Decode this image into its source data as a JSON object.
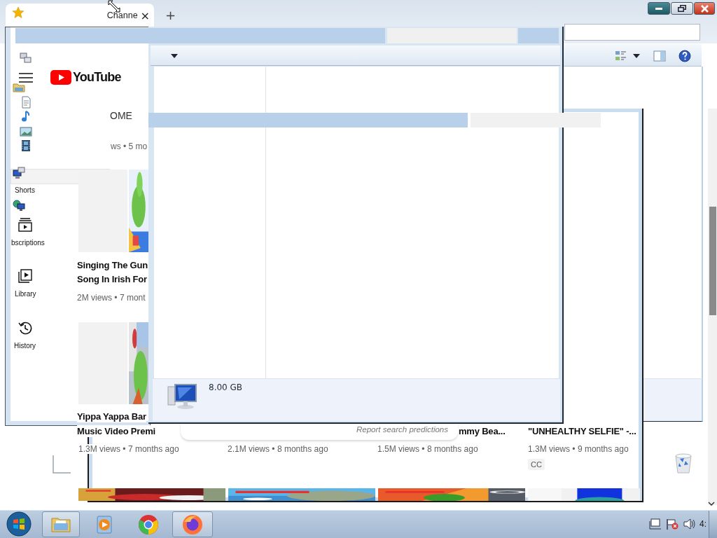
{
  "browser": {
    "tabs": [
      {
        "label": "Channe",
        "close": "×",
        "selected": true
      }
    ],
    "new_tab": "+"
  },
  "youtube": {
    "logo_text": "YouTube",
    "top_chip": "OME",
    "top_meta": "ws • 5 mo",
    "nav_items": [
      {
        "label": "Shorts",
        "kind": "plain"
      },
      {
        "label": "bscriptions",
        "kind": "subscriptions"
      },
      {
        "label": "Library",
        "kind": "library"
      },
      {
        "label": "History",
        "kind": "history"
      }
    ],
    "videos": [
      {
        "title_lines": [
          "Singing The Gun",
          "Song In Irish For"
        ],
        "meta": "2M views • 7 mont"
      },
      {
        "title_lines": [
          "Yippa Yappa Bar",
          "Music Video Premi"
        ],
        "meta": "1.3M views • 7 months ago"
      },
      {
        "meta": "2.1M views • 8 months ago"
      },
      {
        "title_lines": [
          "mmy Bea..."
        ],
        "meta": "1.5M views • 8 months ago"
      },
      {
        "title_lines": [
          "\"UNHEALTHY SELFIE\" -..."
        ],
        "meta": "1.3M views • 9 months ago",
        "badge": "CC"
      }
    ]
  },
  "search_dropdown": {
    "report_link": "Report search predictions"
  },
  "explorer": {
    "details_size": "8.00 GB"
  },
  "taskbar": {
    "apps": [
      {
        "kind": "folder",
        "open": true
      },
      {
        "kind": "media",
        "open": false
      },
      {
        "kind": "chrome",
        "open": false
      },
      {
        "kind": "firefox",
        "open": true
      }
    ],
    "clock": "4:"
  }
}
